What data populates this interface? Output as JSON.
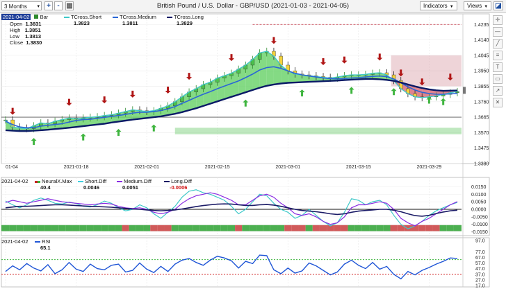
{
  "toolbar": {
    "period": "3 Months",
    "zoom_in": "+",
    "zoom_out": "-",
    "title": "British Pound / U.S. Dollar - GBP/USD (2021-01-03 - 2021-04-05)",
    "indicators": "Indicators",
    "views": "Views"
  },
  "price_panel": {
    "date": "2021-04-02",
    "bar_label": "Bar",
    "ohlc": [
      {
        "label": "Open",
        "value": "1.3831"
      },
      {
        "label": "High",
        "value": "1.3851"
      },
      {
        "label": "Low",
        "value": "1.3813"
      },
      {
        "label": "Close",
        "value": "1.3830"
      }
    ],
    "legend": [
      {
        "name": "TCross.Short",
        "value": "1.3823",
        "color": "#3ec8c8"
      },
      {
        "name": "TCross.Medium",
        "value": "1.3811",
        "color": "#2a66d6"
      },
      {
        "name": "TCross.Long",
        "value": "1.3829",
        "color": "#0a1a66"
      }
    ],
    "y_ticks": [
      "1.4235",
      "1.4140",
      "1.4045",
      "1.3950",
      "1.3855",
      "1.3760",
      "1.3665",
      "1.3570",
      "1.3475",
      "1.3380"
    ],
    "x_ticks": [
      "01-04",
      "2021-01-18",
      "2021-02-01",
      "2021-02-15",
      "2021-03-01",
      "2021-03-15",
      "2021-03-29"
    ]
  },
  "neural_panel": {
    "date": "2021-04-02",
    "legend": [
      {
        "name": "NeuralX.Max",
        "value": "40.4",
        "color": "#cc2222"
      },
      {
        "name": "Short.Diff",
        "value": "0.0046",
        "color": "#40d0e0"
      },
      {
        "name": "Medium.Diff",
        "value": "0.0051",
        "color": "#8a2be2"
      },
      {
        "name": "Long.Diff",
        "value": "-0.0006",
        "color": "#1a1a66"
      }
    ],
    "y_ticks": [
      "0.0150",
      "0.0100",
      "0.0050",
      "0.0000",
      "-0.0050",
      "-0.0100",
      "-0.0150"
    ]
  },
  "rsi_panel": {
    "date": "2021-04-02",
    "name": "RSI",
    "value": "65.1",
    "y_ticks": [
      "97.0",
      "77.0",
      "67.0",
      "57.0",
      "47.0",
      "37.0",
      "27.0",
      "17.0"
    ]
  },
  "colors": {
    "bull_fill": "#6fd46f",
    "bear_fill": "#d9707a",
    "long_line": "#0a1a66",
    "medium_line": "#2a66d6",
    "short_line": "#3ec8c8",
    "up_arrow": "#3fb53f",
    "down_arrow": "#b01515",
    "rsi_line": "#1f55d6"
  },
  "chart_data": [
    {
      "type": "line",
      "title": "British Pound / U.S. Dollar - GBP/USD (2021-01-03 - 2021-04-05)",
      "x": [
        "2021-01-04",
        "2021-01-05",
        "2021-01-06",
        "2021-01-07",
        "2021-01-08",
        "2021-01-11",
        "2021-01-12",
        "2021-01-13",
        "2021-01-14",
        "2021-01-15",
        "2021-01-18",
        "2021-01-19",
        "2021-01-20",
        "2021-01-21",
        "2021-01-22",
        "2021-01-25",
        "2021-01-26",
        "2021-01-27",
        "2021-01-28",
        "2021-01-29",
        "2021-02-01",
        "2021-02-02",
        "2021-02-03",
        "2021-02-04",
        "2021-02-05",
        "2021-02-08",
        "2021-02-09",
        "2021-02-10",
        "2021-02-11",
        "2021-02-12",
        "2021-02-15",
        "2021-02-16",
        "2021-02-17",
        "2021-02-18",
        "2021-02-19",
        "2021-02-22",
        "2021-02-23",
        "2021-02-24",
        "2021-02-25",
        "2021-02-26",
        "2021-03-01",
        "2021-03-02",
        "2021-03-03",
        "2021-03-04",
        "2021-03-05",
        "2021-03-08",
        "2021-03-09",
        "2021-03-10",
        "2021-03-11",
        "2021-03-12",
        "2021-03-15",
        "2021-03-16",
        "2021-03-17",
        "2021-03-18",
        "2021-03-19",
        "2021-03-22",
        "2021-03-23",
        "2021-03-24",
        "2021-03-25",
        "2021-03-26",
        "2021-03-29",
        "2021-03-30",
        "2021-03-31",
        "2021-04-01",
        "2021-04-02"
      ],
      "ylim": [
        1.338,
        1.43
      ],
      "series": [
        {
          "name": "TCross.Short",
          "values": [
            1.3648,
            1.3605,
            1.3598,
            1.3595,
            1.3612,
            1.363,
            1.3625,
            1.364,
            1.365,
            1.366,
            1.3655,
            1.366,
            1.3665,
            1.3668,
            1.3675,
            1.368,
            1.369,
            1.37,
            1.371,
            1.3705,
            1.37,
            1.3705,
            1.372,
            1.3735,
            1.376,
            1.379,
            1.382,
            1.384,
            1.3865,
            1.388,
            1.3905,
            1.392,
            1.3935,
            1.396,
            1.3985,
            1.402,
            1.406,
            1.407,
            1.404,
            1.3985,
            1.395,
            1.393,
            1.3925,
            1.392,
            1.3915,
            1.391,
            1.3905,
            1.3912,
            1.392,
            1.3925,
            1.3925,
            1.3928,
            1.3935,
            1.3938,
            1.3925,
            1.389,
            1.384,
            1.381,
            1.379,
            1.3785,
            1.379,
            1.3795,
            1.3805,
            1.3815,
            1.3823
          ]
        },
        {
          "name": "TCross.Medium",
          "values": [
            1.364,
            1.362,
            1.3605,
            1.36,
            1.36,
            1.361,
            1.3615,
            1.362,
            1.3625,
            1.3635,
            1.3645,
            1.365,
            1.3652,
            1.3658,
            1.3664,
            1.367,
            1.3675,
            1.3682,
            1.369,
            1.3695,
            1.3695,
            1.37,
            1.3706,
            1.3716,
            1.373,
            1.375,
            1.3768,
            1.3788,
            1.3806,
            1.3822,
            1.384,
            1.3856,
            1.3872,
            1.3888,
            1.3908,
            1.393,
            1.3955,
            1.397,
            1.3975,
            1.3965,
            1.395,
            1.3935,
            1.3925,
            1.3918,
            1.3912,
            1.3906,
            1.3902,
            1.39,
            1.3902,
            1.3906,
            1.3908,
            1.3912,
            1.3916,
            1.3918,
            1.3914,
            1.39,
            1.3876,
            1.3852,
            1.3832,
            1.3818,
            1.381,
            1.3806,
            1.3806,
            1.3808,
            1.3811
          ]
        },
        {
          "name": "TCross.Long",
          "values": [
            1.3585,
            1.3582,
            1.358,
            1.358,
            1.3582,
            1.3585,
            1.3588,
            1.3592,
            1.3596,
            1.36,
            1.3605,
            1.361,
            1.3615,
            1.362,
            1.3625,
            1.3632,
            1.3638,
            1.3644,
            1.365,
            1.3655,
            1.366,
            1.3665,
            1.367,
            1.3678,
            1.3686,
            1.3696,
            1.3708,
            1.372,
            1.3734,
            1.3748,
            1.3762,
            1.3776,
            1.379,
            1.3804,
            1.3818,
            1.3832,
            1.3846,
            1.3858,
            1.3866,
            1.3872,
            1.3876,
            1.3878,
            1.388,
            1.3882,
            1.3884,
            1.3886,
            1.3888,
            1.389,
            1.3893,
            1.3896,
            1.3898,
            1.39,
            1.39,
            1.3898,
            1.3894,
            1.3888,
            1.3878,
            1.3866,
            1.3854,
            1.3844,
            1.3836,
            1.383,
            1.3827,
            1.3828,
            1.3829
          ]
        }
      ]
    },
    {
      "type": "line",
      "title": "NeuralX",
      "ylim": [
        -0.0175,
        0.0175
      ],
      "series": [
        {
          "name": "Short.Diff",
          "values": [
            0.0055,
            0.003,
            0.001,
            0.003,
            0.006,
            0.0075,
            0.006,
            0.004,
            0.0035,
            0.0048,
            0.0038,
            0.002,
            0.0015,
            0.003,
            0.0055,
            0.004,
            0.001,
            -0.001,
            0.0,
            0.003,
            0.001,
            -0.003,
            -0.006,
            -0.002,
            0.002,
            0.008,
            0.012,
            0.013,
            0.011,
            0.01,
            0.008,
            0.006,
            0.002,
            -0.003,
            0.0,
            0.005,
            0.01,
            0.009,
            0.004,
            0.0,
            -0.002,
            -0.006,
            -0.004,
            0.0,
            -0.004,
            -0.008,
            -0.011,
            -0.009,
            -0.002,
            0.007,
            0.006,
            0.003,
            0.005,
            0.006,
            0.003,
            -0.004,
            -0.01,
            -0.013,
            -0.011,
            -0.008,
            -0.004,
            -0.001,
            0.001,
            0.003,
            0.0046
          ]
        },
        {
          "name": "Medium.Diff",
          "values": [
            0.0045,
            0.006,
            0.005,
            0.004,
            0.005,
            0.006,
            0.007,
            0.006,
            0.005,
            0.0045,
            0.004,
            0.0035,
            0.003,
            0.0035,
            0.004,
            0.0035,
            0.002,
            0.001,
            0.0005,
            0.001,
            0.0,
            -0.002,
            -0.003,
            -0.002,
            0.0,
            0.004,
            0.007,
            0.009,
            0.01,
            0.011,
            0.01,
            0.008,
            0.006,
            0.003,
            0.003,
            0.006,
            0.009,
            0.01,
            0.008,
            0.004,
            0.001,
            -0.003,
            -0.004,
            -0.003,
            -0.005,
            -0.008,
            -0.01,
            -0.009,
            -0.005,
            0.001,
            0.003,
            0.003,
            0.004,
            0.005,
            0.004,
            0.0,
            -0.006,
            -0.009,
            -0.011,
            -0.008,
            -0.006,
            -0.003,
            0.0,
            0.003,
            0.0051
          ]
        },
        {
          "name": "Long.Diff",
          "values": [
            0.001,
            0.0015,
            0.002,
            0.002,
            0.0022,
            0.0025,
            0.0028,
            0.003,
            0.003,
            0.0028,
            0.0025,
            0.0022,
            0.002,
            0.0018,
            0.0016,
            0.0014,
            0.001,
            0.0006,
            0.0002,
            0.0,
            -0.0004,
            -0.0008,
            -0.001,
            -0.0008,
            -0.0004,
            0.0002,
            0.001,
            0.0018,
            0.0025,
            0.003,
            0.0034,
            0.0036,
            0.0035,
            0.003,
            0.0026,
            0.0026,
            0.003,
            0.0032,
            0.0028,
            0.002,
            0.001,
            0.0,
            -0.0008,
            -0.0012,
            -0.0016,
            -0.0022,
            -0.003,
            -0.0034,
            -0.003,
            -0.002,
            -0.0012,
            -0.0008,
            -0.0004,
            0.0,
            0.0,
            -0.0006,
            -0.0016,
            -0.003,
            -0.0042,
            -0.0046,
            -0.004,
            -0.0028,
            -0.0018,
            -0.001,
            -0.0006
          ]
        }
      ]
    },
    {
      "type": "line",
      "title": "RSI",
      "ylim": [
        17,
        97
      ],
      "series": [
        {
          "name": "RSI",
          "values": [
            42,
            52,
            45,
            56,
            48,
            43,
            54,
            38,
            45,
            58,
            46,
            42,
            55,
            47,
            45,
            53,
            55,
            41,
            44,
            57,
            46,
            40,
            51,
            42,
            55,
            62,
            65,
            58,
            53,
            62,
            69,
            66,
            61,
            48,
            60,
            56,
            71,
            70,
            45,
            38,
            48,
            39,
            43,
            57,
            52,
            44,
            36,
            41,
            55,
            62,
            53,
            47,
            58,
            46,
            51,
            37,
            29,
            42,
            36,
            44,
            49,
            55,
            60,
            66,
            65.1
          ]
        }
      ]
    }
  ]
}
